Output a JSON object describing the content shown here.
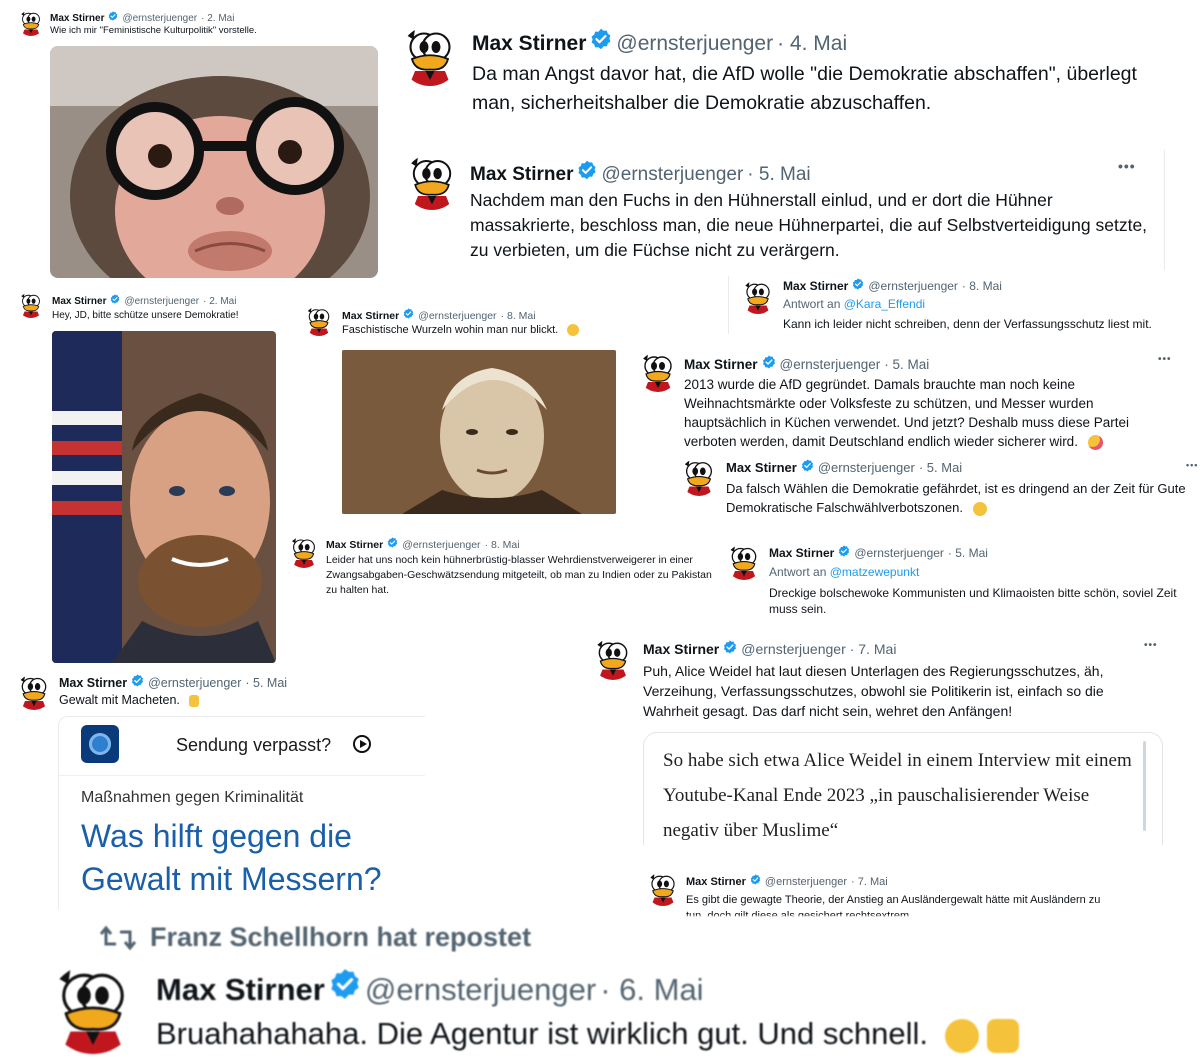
{
  "user": {
    "name": "Max Stirner",
    "handle": "@ernsterjuenger"
  },
  "tweets": [
    {
      "date": "· 2. Mai",
      "text": "Wie ich mir \"Feministische Kulturpolitik\" vorstelle."
    },
    {
      "date": "· 4. Mai",
      "text": "Da man Angst davor hat, die AfD wolle \"die Demokratie abschaffen\", überlegt man, sicherheitshalber die Demokratie abzuschaffen."
    },
    {
      "date": "· 5. Mai",
      "text": "Nachdem man den Fuchs in den Hühnerstall einlud, und er dort die Hühner massakrierte, beschloss man, die neue Hühnerpartei, die auf Selbstverteidigung setzte, zu verbieten, um die Füchse nicht zu verärgern."
    },
    {
      "date": "· 2. Mai",
      "text": "Hey, JD, bitte schütze unsere Demokratie!"
    },
    {
      "date": "· 8. Mai",
      "text": "Faschistische Wurzeln wohin man nur blickt."
    },
    {
      "date": "· 8. Mai",
      "reply_prefix": "Antwort an",
      "reply_to": "@Kara_Effendi",
      "text": "Kann ich leider nicht schreiben, denn der Verfassungsschutz liest mit."
    },
    {
      "date": "· 5. Mai",
      "text": "2013 wurde die AfD gegründet. Damals brauchte man noch keine Weihnachtsmärkte oder Volksfeste zu schützen, und Messer wurden hauptsächlich in Küchen verwendet. Und jetzt? Deshalb muss diese Partei verboten werden, damit Deutschland endlich wieder sicherer wird."
    },
    {
      "date": "· 5. Mai",
      "text": "Da falsch Wählen die Demokratie gefährdet, ist es dringend an der Zeit für Gute Demokratische Falschwählverbotszonen."
    },
    {
      "date": "· 8. Mai",
      "text": "Leider hat uns noch kein hühnerbrüstig-blasser Wehrdienstverweigerer in einer Zwangsabgaben-Geschwätzsendung mitgeteilt, ob man zu Indien oder zu Pakistan zu halten hat."
    },
    {
      "date": "· 5. Mai",
      "reply_prefix": "Antwort an",
      "reply_to": "@matzewepunkt",
      "text": "Dreckige bolschewoke Kommunisten und Klimaoisten bitte schön, soviel Zeit muss sein."
    },
    {
      "date": "· 5. Mai",
      "text": "Gewalt mit Macheten."
    },
    {
      "date": "· 7. Mai",
      "text": "Puh, Alice Weidel hat laut diesen Unterlagen des Regierungsschutzes, äh, Verzeihung, Verfassungsschutzes, obwohl sie Politikerin ist, einfach so die Wahrheit gesagt. Das darf nicht sein, wehret den Anfängen!"
    },
    {
      "date": "· 7. Mai",
      "text": "Es gibt die gewagte Theorie, der Anstieg an Ausländergewalt hätte mit Ausländern zu tun, doch gilt diese als gesichert rechtsextrem."
    },
    {
      "date": "· 6. Mai",
      "text": "Bruahahahaha. Die Agentur ist wirklich gut. Und schnell."
    }
  ],
  "more_label": "•••",
  "repost": {
    "text": "Franz Schellhorn hat repostet"
  },
  "news_card": {
    "sendung": "Sendung verpasst?",
    "kicker": "Maßnahmen gegen Kriminalität",
    "headline": "Was hilft gegen die Gewalt mit Messern?"
  },
  "quote_card": {
    "text": "So habe sich etwa Alice Weidel in einem Interview mit einem Youtube-Kanal Ende 2023 „in pauschalisierender Weise negativ über Muslime“"
  },
  "colors": {
    "verified": "#1d9bf0",
    "handle": "#536471",
    "link": "#1d9bf0",
    "news_blue": "#1a5fa8"
  }
}
